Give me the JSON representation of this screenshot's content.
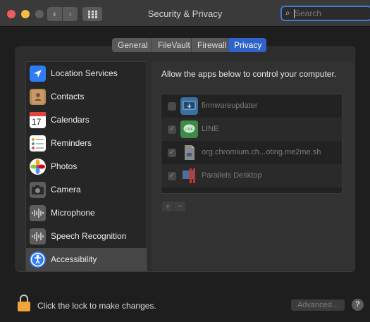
{
  "window": {
    "title": "Security & Privacy",
    "search_placeholder": "Search"
  },
  "tabs": [
    {
      "label": "General"
    },
    {
      "label": "FileVault"
    },
    {
      "label": "Firewall"
    },
    {
      "label": "Privacy",
      "selected": true
    }
  ],
  "sidebar": {
    "items": [
      {
        "label": "Location Services",
        "icon": "location-arrow-icon"
      },
      {
        "label": "Contacts",
        "icon": "contacts-book-icon"
      },
      {
        "label": "Calendars",
        "icon": "calendar-icon",
        "icon_text": "17"
      },
      {
        "label": "Reminders",
        "icon": "reminders-list-icon"
      },
      {
        "label": "Photos",
        "icon": "photos-flower-icon"
      },
      {
        "label": "Camera",
        "icon": "camera-icon"
      },
      {
        "label": "Microphone",
        "icon": "microphone-waveform-icon"
      },
      {
        "label": "Speech Recognition",
        "icon": "speech-waveform-icon"
      },
      {
        "label": "Accessibility",
        "icon": "accessibility-icon",
        "selected": true
      }
    ]
  },
  "panel": {
    "instruction": "Allow the apps below to control your computer.",
    "apps": [
      {
        "name": "firmwareupdater",
        "checked": false,
        "icon": "firmware-updater-icon"
      },
      {
        "name": "LINE",
        "checked": true,
        "icon": "line-app-icon"
      },
      {
        "name": "org.chromium.ch...oting.me2me.sh",
        "checked": true,
        "icon": "script-file-icon"
      },
      {
        "name": "Parallels Desktop",
        "checked": true,
        "icon": "parallels-desktop-icon"
      }
    ],
    "add_label": "+",
    "remove_label": "−"
  },
  "footer": {
    "lock_text": "Click the lock to make changes.",
    "advanced_label": "Advanced...",
    "help_label": "?"
  },
  "colors": {
    "accent": "#2f63c8",
    "lock": "#f0a43a"
  }
}
